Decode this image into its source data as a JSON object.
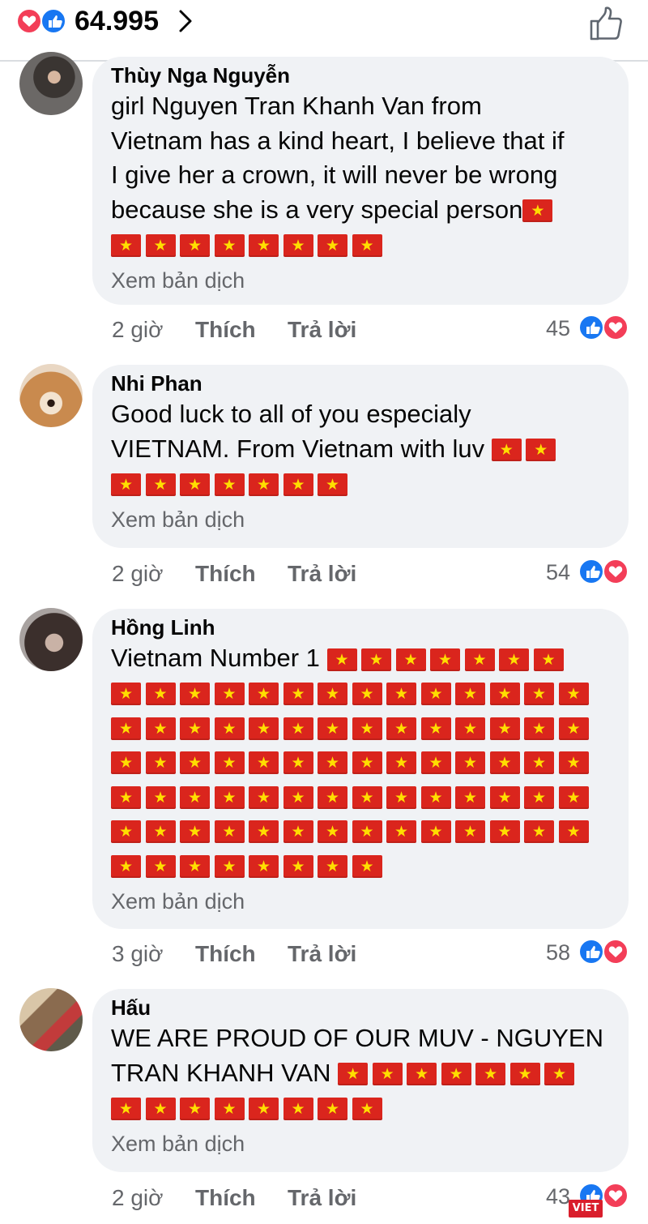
{
  "header": {
    "reaction_count": "64.995",
    "reaction_icons": [
      "heart-icon",
      "like-icon"
    ],
    "chevron_icon": "chevron-right-icon",
    "like_icon": "thumbs-up-outline-icon"
  },
  "labels": {
    "translate": "Xem bản dịch",
    "like": "Thích",
    "reply": "Trả lời"
  },
  "colors": {
    "like_blue": "#1877f2",
    "love_red": "#f33e58",
    "bubble_bg": "#f0f2f5",
    "secondary_text": "#65676b",
    "flag_red": "#da251d",
    "flag_star": "#ffde00"
  },
  "comments": [
    {
      "author": "Thùy Nga Nguyễn",
      "text_lines": [
        "girl Nguyen Tran Khanh Van from",
        "Vietnam has a kind heart, I believe that if",
        "I give her a crown, it will never be wrong",
        "because she is a very special person"
      ],
      "time": "2 giờ",
      "reactions": "45"
    },
    {
      "author": "Nhi Phan",
      "text_lines": [
        "Good luck to all of you especialy",
        "VIETNAM. From Vietnam with luv"
      ],
      "time": "2 giờ",
      "reactions": "54"
    },
    {
      "author": "Hồng Linh",
      "text_lines": [
        "Vietnam Number 1"
      ],
      "time": "3 giờ",
      "reactions": "58"
    },
    {
      "author": "Hấu",
      "text_lines": [
        "WE ARE PROUD OF OUR MUV - NGUYEN",
        "TRAN KHANH VAN"
      ],
      "time": "2 giờ",
      "reactions": "43"
    }
  ],
  "watermark": "VIET"
}
